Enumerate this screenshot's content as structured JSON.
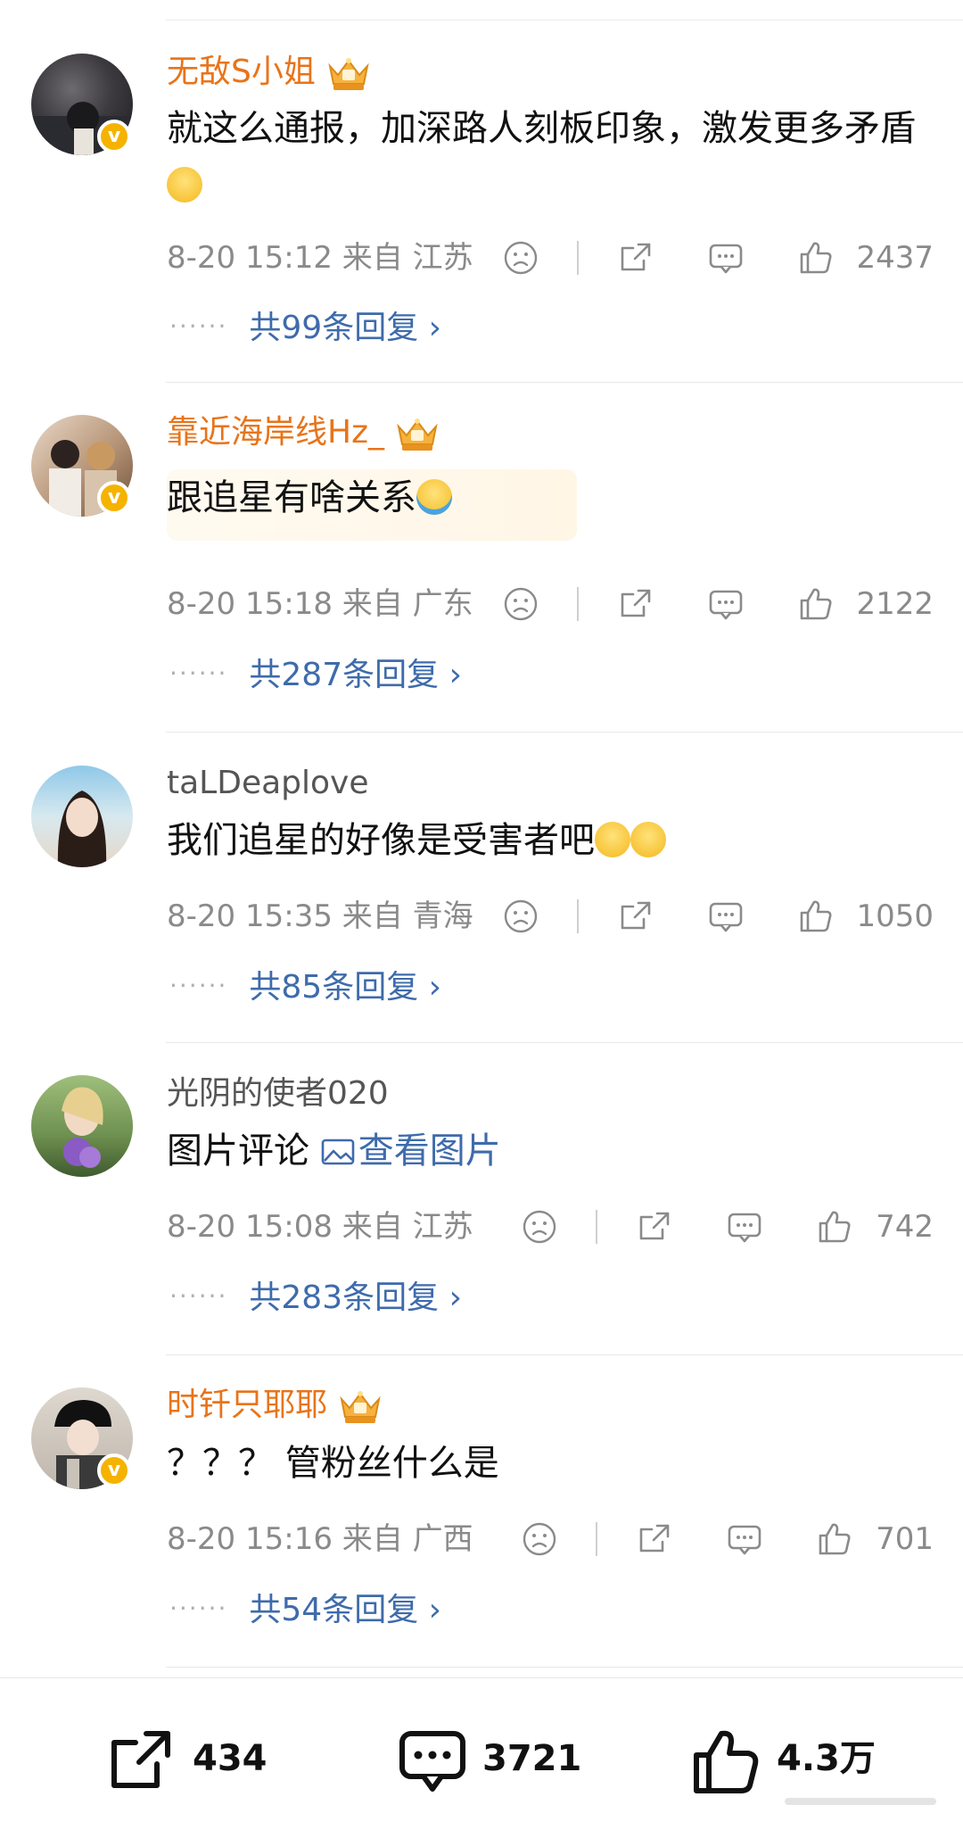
{
  "comments": [
    {
      "username": "无敌S小姐",
      "username_color": "#e8741a",
      "verified": true,
      "vip_crown": true,
      "text": "就这么通报，加深路人刻板印象，激发更多矛盾",
      "emoji": "slightly-smiling-emoji",
      "time": "8-20 15:12",
      "location": "来自 江苏",
      "likes": "2437",
      "replies": "共99条回复"
    },
    {
      "username": "靠近海岸线Hz_",
      "username_color": "#e8741a",
      "verified": true,
      "vip_crown": true,
      "text": "跟追星有啥关系",
      "emoji": "tears-of-joy-emoji",
      "time": "8-20 15:18",
      "location": "来自 广东",
      "likes": "2122",
      "replies": "共287条回复"
    },
    {
      "username": "taLDeaplove",
      "username_color": "#555555",
      "verified": false,
      "vip_crown": false,
      "text": "我们追星的好像是受害者吧",
      "emoji": "sweat-emoji",
      "time": "8-20 15:35",
      "location": "来自 青海",
      "likes": "1050",
      "replies": "共85条回复"
    },
    {
      "username": "光阴的使者020",
      "username_color": "#555555",
      "verified": false,
      "vip_crown": false,
      "text": "图片评论",
      "link_text": "查看图片",
      "time": "8-20 15:08",
      "location": "来自 江苏",
      "likes": "742",
      "replies": "共283条回复"
    },
    {
      "username": "时钎只耶耶",
      "username_color": "#e8741a",
      "verified": true,
      "vip_crown": true,
      "text": "？？？ 管粉丝什么是",
      "time": "8-20 15:16",
      "location": "来自 广西",
      "likes": "701",
      "replies": "共54条回复"
    }
  ],
  "bottom_bar": {
    "share_count": "434",
    "comment_count": "3721",
    "like_count": "4.3万"
  },
  "colors": {
    "username_vip": "#e8741a",
    "link": "#3e6bab",
    "meta_gray": "#8a8a8a",
    "verified_badge": "#f5b300"
  }
}
